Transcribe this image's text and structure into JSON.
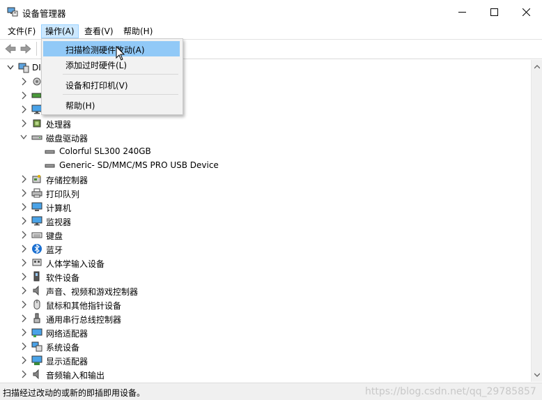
{
  "window": {
    "title": "设备管理器",
    "app_icon": "device-manager-icon"
  },
  "menubar": {
    "items": [
      "文件(F)",
      "操作(A)",
      "查看(V)",
      "帮助(H)"
    ],
    "active": "操作(A)"
  },
  "toolbar": {
    "buttons": [
      "back-arrow-icon",
      "forward-arrow-icon"
    ]
  },
  "dropdown": {
    "items": [
      {
        "label": "扫描检测硬件改动(A)",
        "highlighted": true
      },
      {
        "label": "添加过时硬件(L)"
      },
      {
        "label": "设备和打印机(V)"
      },
      {
        "label": "帮助(H)"
      }
    ]
  },
  "tree": {
    "root": {
      "label": "DI",
      "expanded": true
    },
    "items": [
      {
        "label": "",
        "icon": "audio-inputs-icon",
        "level": 1
      },
      {
        "label": "",
        "icon": "battery-icon",
        "level": 1
      },
      {
        "label": "",
        "icon": "monitor-icon",
        "level": 1
      },
      {
        "label": "处理器",
        "icon": "processor-icon",
        "level": 1
      },
      {
        "label": "磁盘驱动器",
        "icon": "disk-drive-icon",
        "level": 1,
        "expanded": true
      },
      {
        "label": "Colorful SL300 240GB",
        "icon": "disk-icon",
        "level": 2
      },
      {
        "label": "Generic- SD/MMC/MS PRO USB Device",
        "icon": "disk-icon",
        "level": 2
      },
      {
        "label": "存储控制器",
        "icon": "storage-controller-icon",
        "level": 1
      },
      {
        "label": "打印队列",
        "icon": "printer-icon",
        "level": 1
      },
      {
        "label": "计算机",
        "icon": "computer-icon",
        "level": 1
      },
      {
        "label": "监视器",
        "icon": "monitor-icon",
        "level": 1
      },
      {
        "label": "键盘",
        "icon": "keyboard-icon",
        "level": 1
      },
      {
        "label": "蓝牙",
        "icon": "bluetooth-icon",
        "level": 1
      },
      {
        "label": "人体学输入设备",
        "icon": "hid-icon",
        "level": 1
      },
      {
        "label": "软件设备",
        "icon": "software-device-icon",
        "level": 1
      },
      {
        "label": "声音、视频和游戏控制器",
        "icon": "speaker-icon",
        "level": 1
      },
      {
        "label": "鼠标和其他指针设备",
        "icon": "mouse-icon",
        "level": 1
      },
      {
        "label": "通用串行总线控制器",
        "icon": "usb-icon",
        "level": 1
      },
      {
        "label": "网络适配器",
        "icon": "network-adapter-icon",
        "level": 1
      },
      {
        "label": "系统设备",
        "icon": "system-device-icon",
        "level": 1
      },
      {
        "label": "显示适配器",
        "icon": "display-adapter-icon",
        "level": 1
      },
      {
        "label": "音频输入和输出",
        "icon": "speaker-icon",
        "level": 1
      }
    ]
  },
  "statusbar": {
    "text": "扫描经过改动的或新的即插即用设备。",
    "watermark": "https://blog.csdn.net/qq_29785857"
  },
  "colors": {
    "menu_active_bg": "#cce8ff",
    "dropdown_highlight": "#91c9f7",
    "dropdown_bg": "#f2f2f2"
  }
}
